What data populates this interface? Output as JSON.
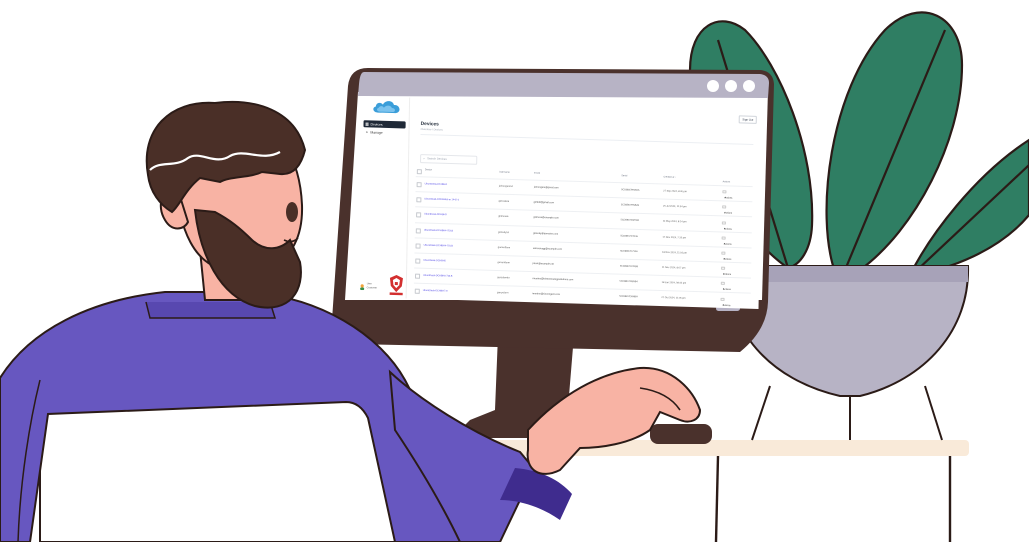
{
  "app": {
    "sidebar": {
      "items": [
        {
          "icon": "grid-icon",
          "glyph": "▦",
          "label": "Devices",
          "active": true
        },
        {
          "icon": "plus-icon",
          "glyph": "+",
          "label": "Manage",
          "active": false
        }
      ],
      "user": {
        "line1": "User",
        "line2": "Customer"
      }
    },
    "header": {
      "sign_out_label": "Sign Out"
    },
    "page": {
      "title": "Devices",
      "breadcrumb": "Overview / Devices"
    },
    "search": {
      "placeholder": "Search Devices"
    },
    "table": {
      "columns": [
        "Device",
        "Username",
        "Email",
        "Serial",
        "Created at ↓",
        "Actions"
      ],
      "rows": [
        {
          "device": "UbuntDesk-DCHBH1",
          "username": "johnrogers04",
          "email": "johnrogers@gmail.com",
          "serial": "5CD8B07RNB2A",
          "created": "27 Sep 2024, 8:40 pm",
          "action": "Actions"
        },
        {
          "device": "UbuntDesk-DCHBHtxt-m 1442-2",
          "username": "girlcoder6",
          "email": "girlbrill@gmail.com",
          "serial": "5CD8B07RNB28",
          "created": "25 Jul 2024, 11:54 pm",
          "action": "Actions"
        },
        {
          "device": "UbuntDesk-DCHBH3",
          "username": "girlmore6",
          "email": "girlmore@example.com",
          "serial": "5CD8B07RM7B3",
          "created": "14 May 2024, 8:14 pm",
          "action": "Actions"
        },
        {
          "device": "UbuntDesk-DCHBH4-7DLB",
          "username": "girlcody04",
          "email": "girlcody@domains.com",
          "serial": "5CD8B07D7036",
          "created": "17 Nov 2024, 7:15 pm",
          "action": "Actions"
        },
        {
          "device": "UbuntDesk-DCHBH4-7DLB",
          "username": "garrentfarm",
          "email": "retorrenagg@example.com",
          "serial": "5CD8B07D7336",
          "created": "18 Nov 2024, 11:16 pm",
          "action": "Actions"
        },
        {
          "device": "UbuntDesk-DCHBH5",
          "username": "garrentfarm",
          "email": "johnk@example.net",
          "serial": "5CD8B07D7RB9",
          "created": "11 Nov 2024, 8:07 pm",
          "action": "Actions"
        },
        {
          "device": "UbuntDesk-DCHBH6-7DLB",
          "username": "garryfarmbr",
          "email": "rmartins@brittonstrategysolutions.com",
          "serial": "5CD8B07D9NB4",
          "created": "18 Jan 2024, 09:43 pm",
          "action": "Actions"
        },
        {
          "device": "UbuntDesk-DCHBH7-9",
          "username": "garrycfarm",
          "email": "rmartins@sinceagent.com",
          "serial": "5CD8B07D9NBH",
          "created": "27 Oct 2024, 11:05 pm",
          "action": "Actions"
        }
      ]
    }
  },
  "colors": {
    "shirt": "#6757c0",
    "shirt_dark": "#3f2c8e",
    "hair": "#4a2f27",
    "skin": "#f8b3a4",
    "monitor_frame": "#4a312c",
    "leaf": "#2f7e63",
    "pot": "#b7b3c5",
    "desk": "#f9ead9",
    "accent_link": "#4f46e5",
    "cloud": "#3b9ed9"
  }
}
